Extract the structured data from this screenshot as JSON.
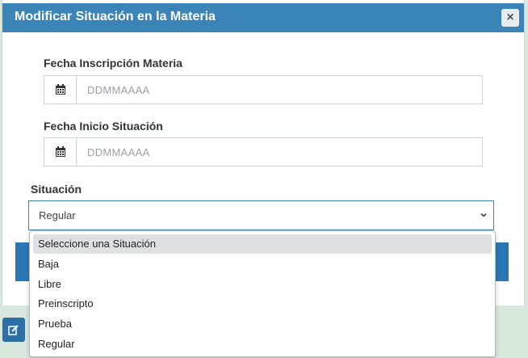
{
  "modal": {
    "title": "Modificar Situación en la Materia",
    "close_label": "×"
  },
  "form": {
    "fecha_inscripcion": {
      "label": "Fecha Inscripción Materia",
      "placeholder": "DDMMAAAA",
      "value": ""
    },
    "fecha_inicio": {
      "label": "Fecha Inicio Situación",
      "placeholder": "DDMMAAAA",
      "value": ""
    },
    "situacion": {
      "label": "Situación",
      "selected": "Regular",
      "options": [
        "Seleccione una Situación",
        "Baja",
        "Libre",
        "Preinscripto",
        "Prueba",
        "Regular"
      ]
    }
  },
  "icons": {
    "calendar": "calendar-icon",
    "chevron": "chevron-down-icon",
    "edit": "edit-icon"
  },
  "colors": {
    "header": "#3a84b8",
    "accent": "#2a77b5",
    "background": "#d9e8dc"
  }
}
